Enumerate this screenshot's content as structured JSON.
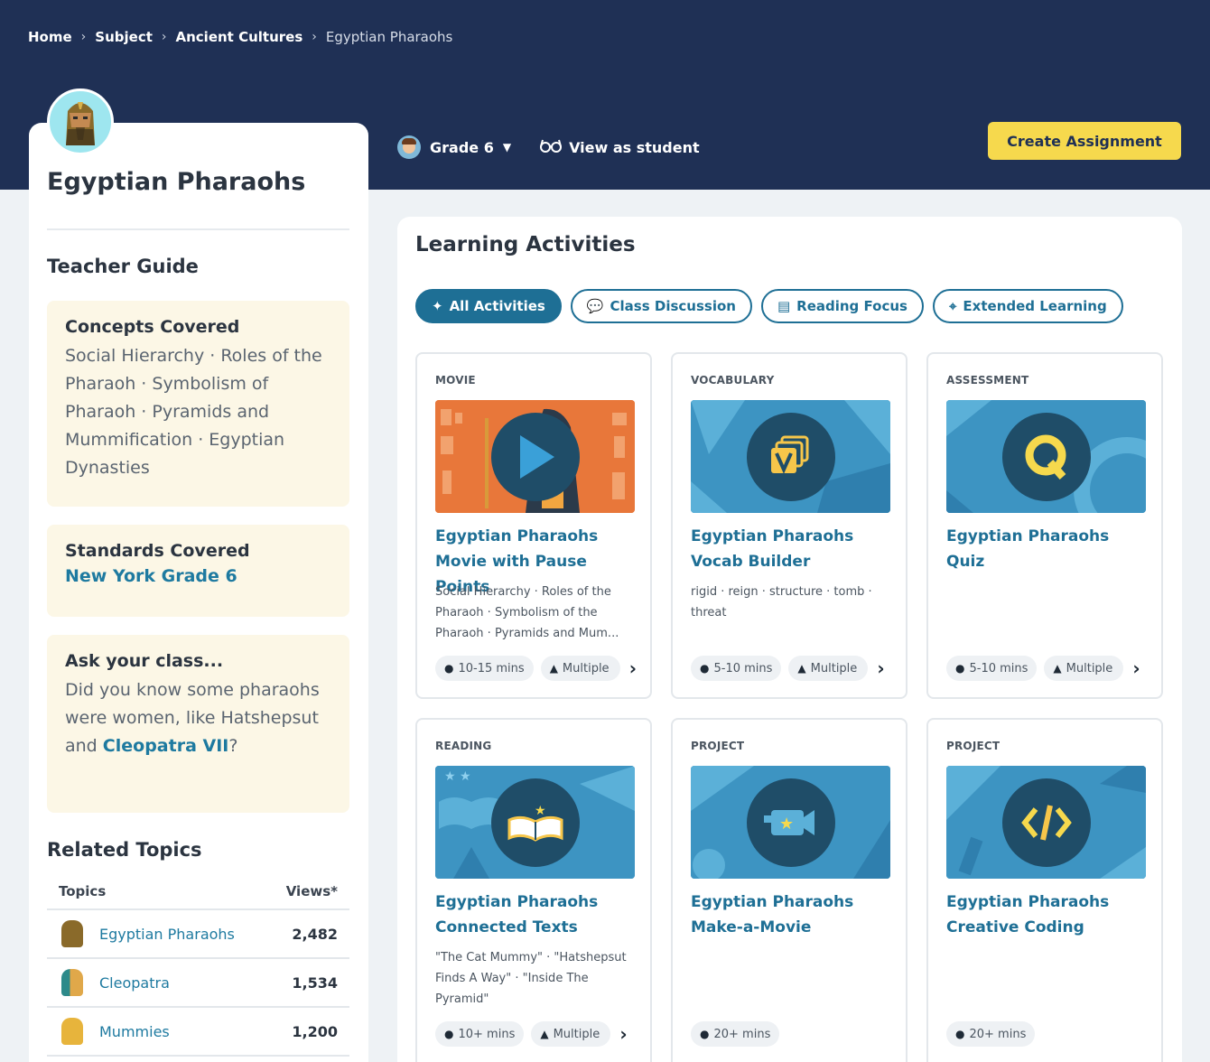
{
  "breadcrumb": {
    "items": [
      "Home",
      "Subject",
      "Ancient Cultures",
      "Egyptian Pharaohs"
    ]
  },
  "toolbar": {
    "grade_label": "Grade 6",
    "view_as_student": "View as student",
    "create_assignment": "Create Assignment"
  },
  "subject": {
    "title": "Egyptian Pharaohs"
  },
  "teacher_guide": {
    "heading": "Teacher Guide",
    "concepts_title": "Concepts Covered",
    "concepts_text": "Social Hierarchy · Roles of the Pharaoh · Symbolism of Pharaoh · Pyramids and Mummification · Egyptian Dynasties",
    "standards_title": "Standards Covered",
    "standards_link": "New York Grade 6",
    "ask_title": "Ask your class...",
    "ask_text_before": "Did you know some pharaohs were women, like Hatshepsut and ",
    "ask_link": "Cleopatra VII",
    "ask_text_after": "?"
  },
  "related_topics": {
    "heading": "Related Topics",
    "col_topics": "Topics",
    "col_views": "Views*",
    "rows": [
      {
        "name": "Egyptian Pharaohs",
        "views": "2,482"
      },
      {
        "name": "Cleopatra",
        "views": "1,534"
      },
      {
        "name": "Mummies",
        "views": "1,200"
      }
    ]
  },
  "activities": {
    "heading": "Learning Activities",
    "filters": [
      "All Activities",
      "Class Discussion",
      "Reading Focus",
      "Extended Learning"
    ],
    "active_filter": "All Activities",
    "cards": [
      {
        "type": "MOVIE",
        "title": "Egyptian Pharaohs Movie with Pause Points",
        "desc": "Social Hierarchy · Roles of the Pharaoh · Symbolism of the Pharaoh · Pyramids and Mum...",
        "time": "10-15 mins",
        "level": "Multiple",
        "icon": "play-icon"
      },
      {
        "type": "VOCABULARY",
        "title": "Egyptian Pharaohs Vocab Builder",
        "desc": "rigid · reign · structure · tomb · threat",
        "time": "5-10 mins",
        "level": "Multiple",
        "icon": "vocab-cards-icon"
      },
      {
        "type": "ASSESSMENT",
        "title": "Egyptian Pharaohs Quiz",
        "desc": "",
        "time": "5-10 mins",
        "level": "Multiple",
        "icon": "quiz-q-icon"
      },
      {
        "type": "READING",
        "title": "Egyptian Pharaohs Connected Texts",
        "desc": "\"The Cat Mummy\" · \"Hatshepsut Finds A Way\" · \"Inside The Pyramid\"",
        "time": "10+ mins",
        "level": "Multiple",
        "icon": "open-book-icon"
      },
      {
        "type": "PROJECT",
        "title": "Egyptian Pharaohs Make-a-Movie",
        "desc": "",
        "time": "20+ mins",
        "level": "",
        "icon": "video-camera-icon"
      },
      {
        "type": "PROJECT",
        "title": "Egyptian Pharaohs Creative Coding",
        "desc": "",
        "time": "20+ mins",
        "level": "",
        "icon": "code-brackets-icon"
      }
    ]
  },
  "colors": {
    "header_navy": "#1f3055",
    "accent_teal": "#1e6f95",
    "button_yellow": "#f6d94d",
    "guide_cream": "#fcf7e6"
  }
}
